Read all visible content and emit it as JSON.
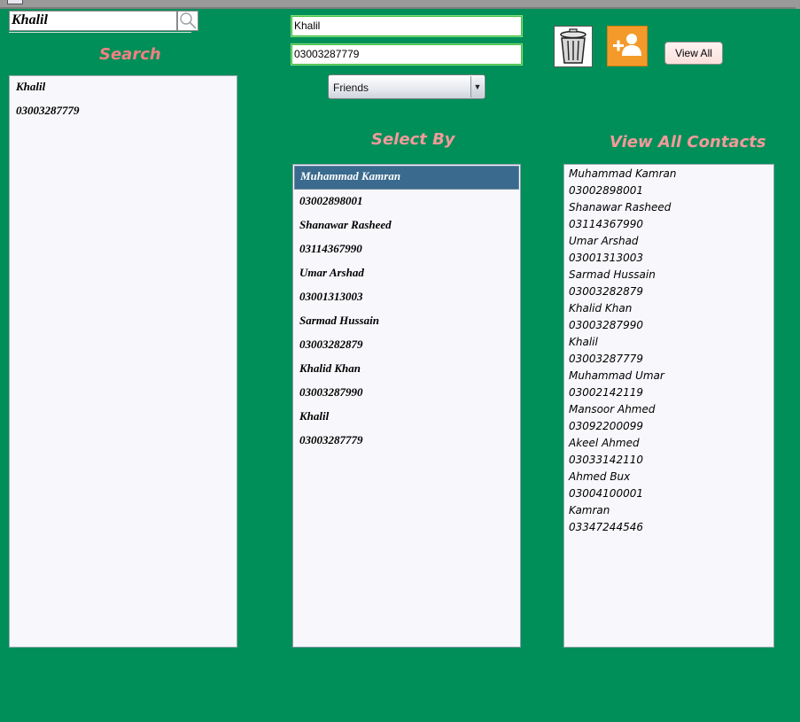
{
  "search": {
    "query": "Khalil",
    "heading": "Search",
    "results": [
      "Khalil",
      "03003287779"
    ]
  },
  "form": {
    "name_value": "Khalil",
    "phone_value": "03003287779",
    "group_selected": "Friends"
  },
  "toolbar": {
    "delete_icon": "trash-can-icon",
    "add_icon": "add-user-icon",
    "view_all_label": "View All"
  },
  "select_by": {
    "heading": "Select By",
    "items": [
      "Muhammad Kamran",
      "03002898001",
      "Shanawar Rasheed",
      "03114367990",
      "Umar Arshad",
      "03001313003",
      "Sarmad Hussain",
      "03003282879",
      "Khalid Khan",
      "03003287990",
      "Khalil",
      "03003287779"
    ]
  },
  "all_contacts": {
    "heading": "View All Contacts",
    "items": [
      "Muhammad Kamran",
      "03002898001",
      "Shanawar Rasheed",
      "03114367990",
      "Umar Arshad",
      "03001313003",
      "Sarmad Hussain",
      "03003282879",
      "Khalid Khan",
      "03003287990",
      "Khalil",
      "03003287779",
      "Muhammad Umar",
      "03002142119",
      "Mansoor Ahmed",
      "03092200099",
      "Akeel Ahmed",
      "03033142110",
      "Ahmed Bux",
      "03004100001",
      "Kamran",
      "03347244546"
    ]
  },
  "colors": {
    "background": "#008f59",
    "heading": "#f39a9a",
    "selection": "#3a6a8e",
    "add_button": "#f39a2a"
  }
}
